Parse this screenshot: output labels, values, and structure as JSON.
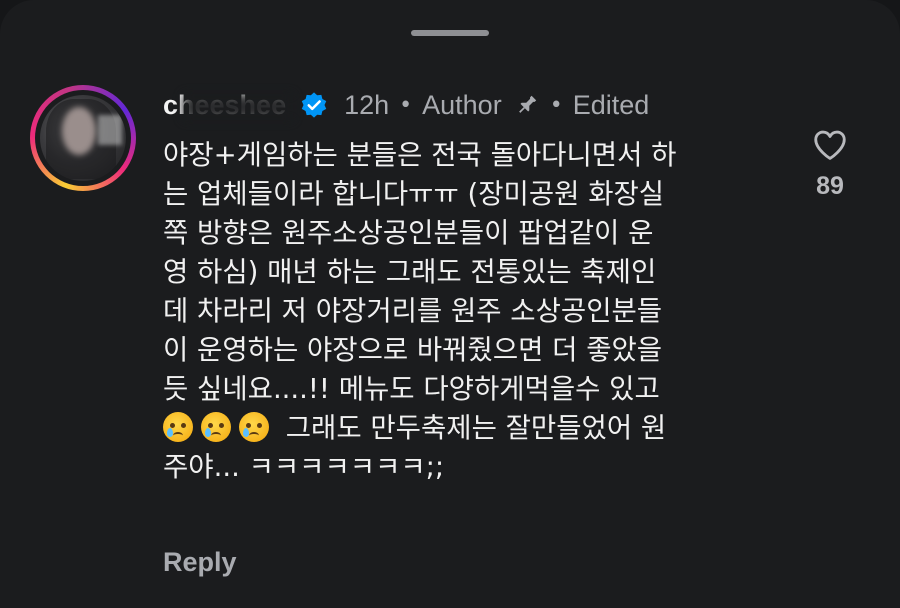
{
  "comment": {
    "username": "cheeshee",
    "time": "12h",
    "author_label": "Author",
    "edited_label": "Edited",
    "separator": "•",
    "lines": [
      "야장+게임하는 분들은 전국 돌아다니면서 하",
      "는 업체들이라 합니다ㅠㅠ (장미공원 화장실",
      "쪽 방향은 원주소상공인분들이 팝업같이 운",
      "영 하심) 매년 하는 그래도 전통있는 축제인",
      "데 차라리 저 야장거리를 원주 소상공인분들",
      "이 운영하는 야장으로 바꿔줬으면 더 좋았을",
      "듯 싶네요....!! 메뉴도 다양하게먹을수 있고"
    ],
    "emoji_line_text": " 그래도 만두축제는 잘만들었어 원",
    "last_line": "주야... ㅋㅋㅋㅋㅋㅋㅋ;;",
    "emoji_count": 3,
    "emoji_name": "crying-face",
    "like_count": "89",
    "reply_label": "Reply"
  },
  "icons": {
    "verified": "verified-badge-icon",
    "pin": "pin-icon",
    "like": "heart-icon"
  },
  "colors": {
    "background": "#1b1c1e",
    "text": "#f1f1f1",
    "muted": "#a9abb0",
    "verified": "#0095f6"
  }
}
